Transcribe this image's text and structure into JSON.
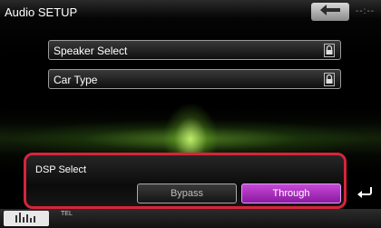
{
  "header": {
    "title": "Audio SETUP",
    "clock": "--:--",
    "back_icon": "back-arrow-icon"
  },
  "menu": {
    "items": [
      {
        "label": "Speaker Select",
        "icon": "lock-icon"
      },
      {
        "label": "Car Type",
        "icon": "lock-icon"
      }
    ]
  },
  "dsp": {
    "label": "DSP Select",
    "options": [
      {
        "label": "Bypass",
        "selected": false
      },
      {
        "label": "Through",
        "selected": true
      }
    ],
    "highlight_color": "#d5253a",
    "selected_color": "#b030c8"
  },
  "footer": {
    "eq_icon": "equalizer-icon",
    "tel_label": "TEL",
    "return_icon": "return-arrow-icon"
  }
}
